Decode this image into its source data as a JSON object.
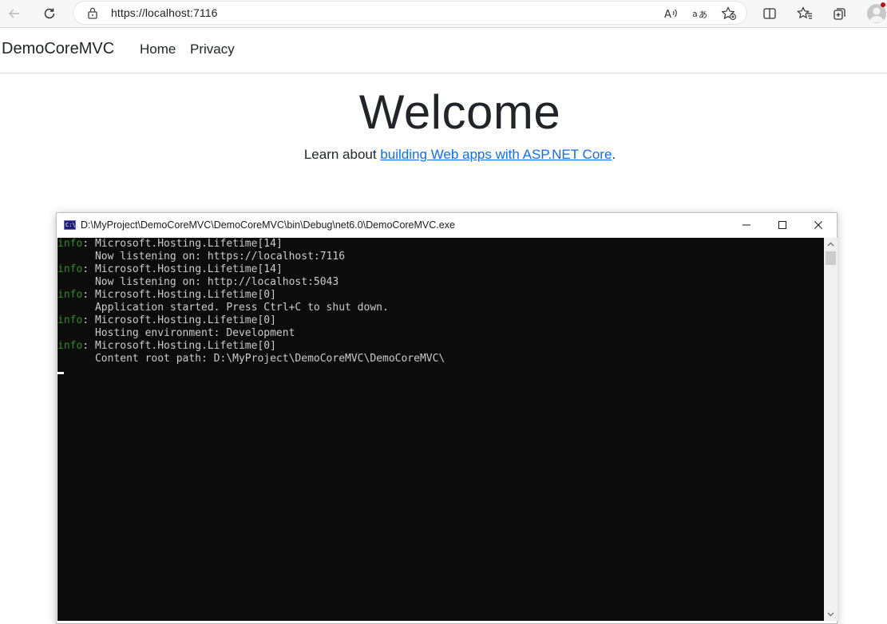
{
  "browser": {
    "url": "https://localhost:7116",
    "icons": [
      "back-arrow-icon",
      "refresh-icon",
      "lock-icon",
      "read-aloud-icon",
      "translate-icon",
      "favorites-add-icon",
      "split-screen-icon",
      "favorites-icon",
      "collections-icon",
      "profile-icon"
    ]
  },
  "site": {
    "brand": "DemoCoreMVC",
    "nav": {
      "home": "Home",
      "privacy": "Privacy"
    },
    "heading": "Welcome",
    "learn_prefix": "Learn about ",
    "learn_link": "building Web apps with ASP.NET Core",
    "learn_suffix": ".",
    "link_color": "#0d6efd"
  },
  "console": {
    "title": "D:\\MyProject\\DemoCoreMVC\\DemoCoreMVC\\bin\\Debug\\net6.0\\DemoCoreMVC.exe",
    "icon_label": "C:\\",
    "level_color": "#13a10e",
    "lines": [
      {
        "level": "info",
        "text": ": Microsoft.Hosting.Lifetime[14]"
      },
      {
        "level": "",
        "text": "      Now listening on: https://localhost:7116"
      },
      {
        "level": "info",
        "text": ": Microsoft.Hosting.Lifetime[14]"
      },
      {
        "level": "",
        "text": "      Now listening on: http://localhost:5043"
      },
      {
        "level": "info",
        "text": ": Microsoft.Hosting.Lifetime[0]"
      },
      {
        "level": "",
        "text": "      Application started. Press Ctrl+C to shut down."
      },
      {
        "level": "info",
        "text": ": Microsoft.Hosting.Lifetime[0]"
      },
      {
        "level": "",
        "text": "      Hosting environment: Development"
      },
      {
        "level": "info",
        "text": ": Microsoft.Hosting.Lifetime[0]"
      },
      {
        "level": "",
        "text": "      Content root path: D:\\MyProject\\DemoCoreMVC\\DemoCoreMVC\\"
      }
    ]
  }
}
